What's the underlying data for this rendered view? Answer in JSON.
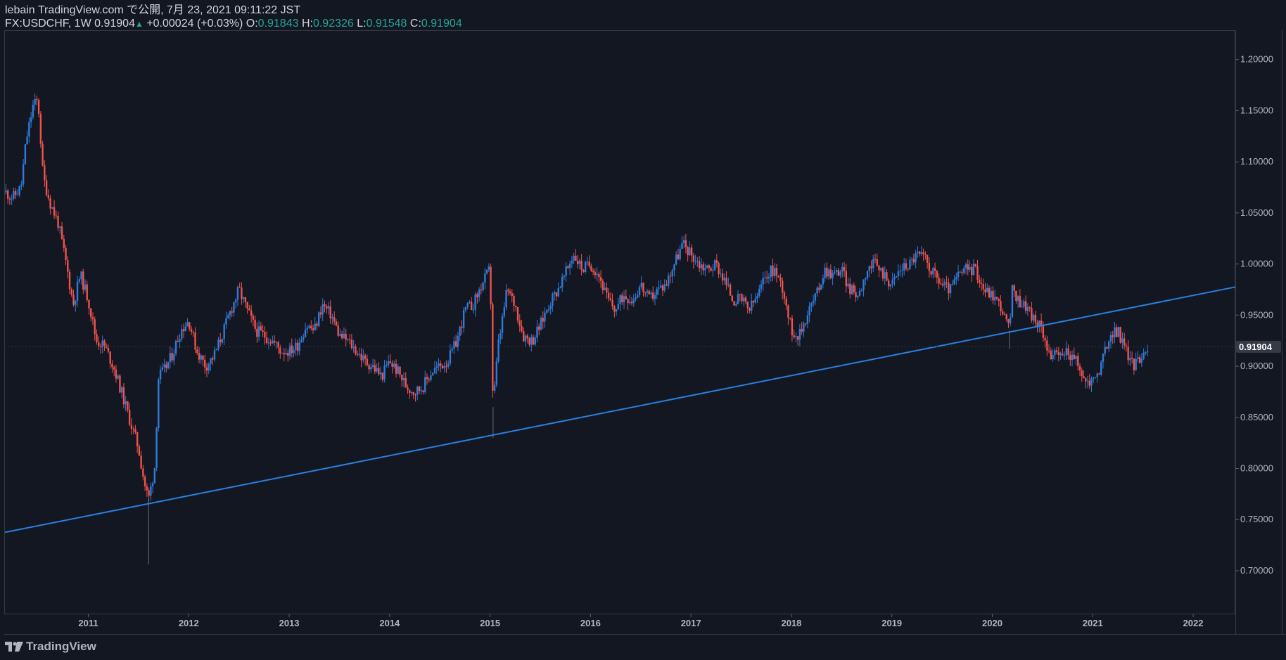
{
  "header": {
    "line1": "lebain TradingView.com で公開, 7月 23, 2021 09:11:22 JST",
    "symbol": "FX:USDCHF, 1W",
    "last": "0.91904",
    "change": "+0.00024 (+0.03%)",
    "open_label": "O:",
    "open_value": "0.91843",
    "high_label": "H:",
    "high_value": "0.92326",
    "low_label": "L:",
    "low_value": "0.91548",
    "close_label": "C:",
    "close_value": "0.91904"
  },
  "brand": {
    "name": "TradingView",
    "icon": "tradingview-logo-icon"
  },
  "colors": {
    "background": "#131722",
    "up": "#2f7bd9",
    "down": "#f0524d",
    "trendline": "#2a7fde",
    "text": "#b2b5be",
    "change_up": "#26a69a",
    "price_tag_bg": "#363a45"
  },
  "chart_data": {
    "type": "candlestick",
    "symbol": "FX:USDCHF",
    "interval": "1W",
    "x_ticks": [
      "2011",
      "2012",
      "2013",
      "2014",
      "2015",
      "2016",
      "2017",
      "2018",
      "2019",
      "2020",
      "2021",
      "2022"
    ],
    "y_ticks": [
      "1.20000",
      "1.15000",
      "1.10000",
      "1.05000",
      "1.00000",
      "0.95000",
      "0.90000",
      "0.85000",
      "0.80000",
      "0.75000",
      "0.70000"
    ],
    "ylim": [
      0.658,
      1.228
    ],
    "xlim": [
      2010.17,
      2022.42
    ],
    "last_price": "0.91904",
    "close_path": [
      [
        2010.18,
        1.07
      ],
      [
        2010.25,
        1.065
      ],
      [
        2010.33,
        1.075
      ],
      [
        2010.38,
        1.12
      ],
      [
        2010.45,
        1.155
      ],
      [
        2010.5,
        1.16
      ],
      [
        2010.55,
        1.085
      ],
      [
        2010.62,
        1.06
      ],
      [
        2010.7,
        1.04
      ],
      [
        2010.78,
        1.0
      ],
      [
        2010.85,
        0.96
      ],
      [
        2010.92,
        0.99
      ],
      [
        2011.0,
        0.965
      ],
      [
        2011.08,
        0.925
      ],
      [
        2011.16,
        0.92
      ],
      [
        2011.25,
        0.9
      ],
      [
        2011.33,
        0.875
      ],
      [
        2011.42,
        0.845
      ],
      [
        2011.5,
        0.82
      ],
      [
        2011.56,
        0.785
      ],
      [
        2011.6,
        0.77
      ],
      [
        2011.66,
        0.8
      ],
      [
        2011.7,
        0.89
      ],
      [
        2011.75,
        0.895
      ],
      [
        2011.83,
        0.91
      ],
      [
        2011.92,
        0.935
      ],
      [
        2012.0,
        0.945
      ],
      [
        2012.08,
        0.915
      ],
      [
        2012.17,
        0.9
      ],
      [
        2012.25,
        0.91
      ],
      [
        2012.33,
        0.93
      ],
      [
        2012.42,
        0.955
      ],
      [
        2012.5,
        0.975
      ],
      [
        2012.58,
        0.955
      ],
      [
        2012.67,
        0.935
      ],
      [
        2012.75,
        0.93
      ],
      [
        2012.83,
        0.925
      ],
      [
        2012.92,
        0.915
      ],
      [
        2013.0,
        0.915
      ],
      [
        2013.08,
        0.92
      ],
      [
        2013.17,
        0.94
      ],
      [
        2013.25,
        0.935
      ],
      [
        2013.33,
        0.96
      ],
      [
        2013.42,
        0.95
      ],
      [
        2013.5,
        0.93
      ],
      [
        2013.58,
        0.925
      ],
      [
        2013.67,
        0.915
      ],
      [
        2013.75,
        0.905
      ],
      [
        2013.83,
        0.9
      ],
      [
        2013.92,
        0.89
      ],
      [
        2014.0,
        0.905
      ],
      [
        2014.08,
        0.895
      ],
      [
        2014.17,
        0.88
      ],
      [
        2014.25,
        0.875
      ],
      [
        2014.33,
        0.88
      ],
      [
        2014.42,
        0.895
      ],
      [
        2014.5,
        0.9
      ],
      [
        2014.58,
        0.905
      ],
      [
        2014.67,
        0.925
      ],
      [
        2014.75,
        0.955
      ],
      [
        2014.83,
        0.96
      ],
      [
        2014.92,
        0.98
      ],
      [
        2015.0,
        0.995
      ],
      [
        2015.03,
        0.86
      ],
      [
        2015.08,
        0.92
      ],
      [
        2015.17,
        0.975
      ],
      [
        2015.25,
        0.96
      ],
      [
        2015.33,
        0.93
      ],
      [
        2015.42,
        0.925
      ],
      [
        2015.5,
        0.94
      ],
      [
        2015.58,
        0.96
      ],
      [
        2015.67,
        0.975
      ],
      [
        2015.75,
        0.99
      ],
      [
        2015.83,
        1.01
      ],
      [
        2015.92,
        0.995
      ],
      [
        2016.0,
        1.0
      ],
      [
        2016.08,
        0.99
      ],
      [
        2016.17,
        0.965
      ],
      [
        2016.25,
        0.955
      ],
      [
        2016.33,
        0.97
      ],
      [
        2016.42,
        0.965
      ],
      [
        2016.5,
        0.98
      ],
      [
        2016.58,
        0.965
      ],
      [
        2016.67,
        0.975
      ],
      [
        2016.75,
        0.98
      ],
      [
        2016.83,
        1.0
      ],
      [
        2016.92,
        1.02
      ],
      [
        2017.0,
        1.01
      ],
      [
        2017.08,
        1.0
      ],
      [
        2017.17,
        0.995
      ],
      [
        2017.25,
        1.0
      ],
      [
        2017.33,
        0.985
      ],
      [
        2017.42,
        0.965
      ],
      [
        2017.5,
        0.965
      ],
      [
        2017.58,
        0.955
      ],
      [
        2017.67,
        0.97
      ],
      [
        2017.75,
        0.99
      ],
      [
        2017.83,
        0.995
      ],
      [
        2017.92,
        0.975
      ],
      [
        2018.0,
        0.935
      ],
      [
        2018.08,
        0.93
      ],
      [
        2018.17,
        0.955
      ],
      [
        2018.25,
        0.97
      ],
      [
        2018.33,
        0.995
      ],
      [
        2018.42,
        0.99
      ],
      [
        2018.5,
        0.995
      ],
      [
        2018.58,
        0.975
      ],
      [
        2018.67,
        0.97
      ],
      [
        2018.75,
        0.995
      ],
      [
        2018.83,
        1.0
      ],
      [
        2018.92,
        0.99
      ],
      [
        2019.0,
        0.98
      ],
      [
        2019.08,
        0.995
      ],
      [
        2019.17,
        1.0
      ],
      [
        2019.25,
        1.01
      ],
      [
        2019.33,
        1.005
      ],
      [
        2019.42,
        0.99
      ],
      [
        2019.5,
        0.98
      ],
      [
        2019.58,
        0.975
      ],
      [
        2019.67,
        0.99
      ],
      [
        2019.75,
        0.995
      ],
      [
        2019.83,
        0.995
      ],
      [
        2019.92,
        0.975
      ],
      [
        2020.0,
        0.97
      ],
      [
        2020.08,
        0.96
      ],
      [
        2020.17,
        0.935
      ],
      [
        2020.2,
        0.975
      ],
      [
        2020.25,
        0.965
      ],
      [
        2020.33,
        0.96
      ],
      [
        2020.42,
        0.945
      ],
      [
        2020.5,
        0.935
      ],
      [
        2020.58,
        0.91
      ],
      [
        2020.67,
        0.91
      ],
      [
        2020.75,
        0.915
      ],
      [
        2020.83,
        0.905
      ],
      [
        2020.92,
        0.885
      ],
      [
        2021.0,
        0.885
      ],
      [
        2021.08,
        0.9
      ],
      [
        2021.17,
        0.93
      ],
      [
        2021.25,
        0.935
      ],
      [
        2021.33,
        0.915
      ],
      [
        2021.42,
        0.9
      ],
      [
        2021.5,
        0.915
      ],
      [
        2021.55,
        0.919
      ]
    ],
    "lows": [
      [
        2011.6,
        0.706
      ],
      [
        2015.03,
        0.83
      ],
      [
        2020.17,
        0.917
      ]
    ],
    "trendline": {
      "x1": 2010.17,
      "y1": 0.7375,
      "x2": 2022.42,
      "y2": 0.9775
    }
  }
}
